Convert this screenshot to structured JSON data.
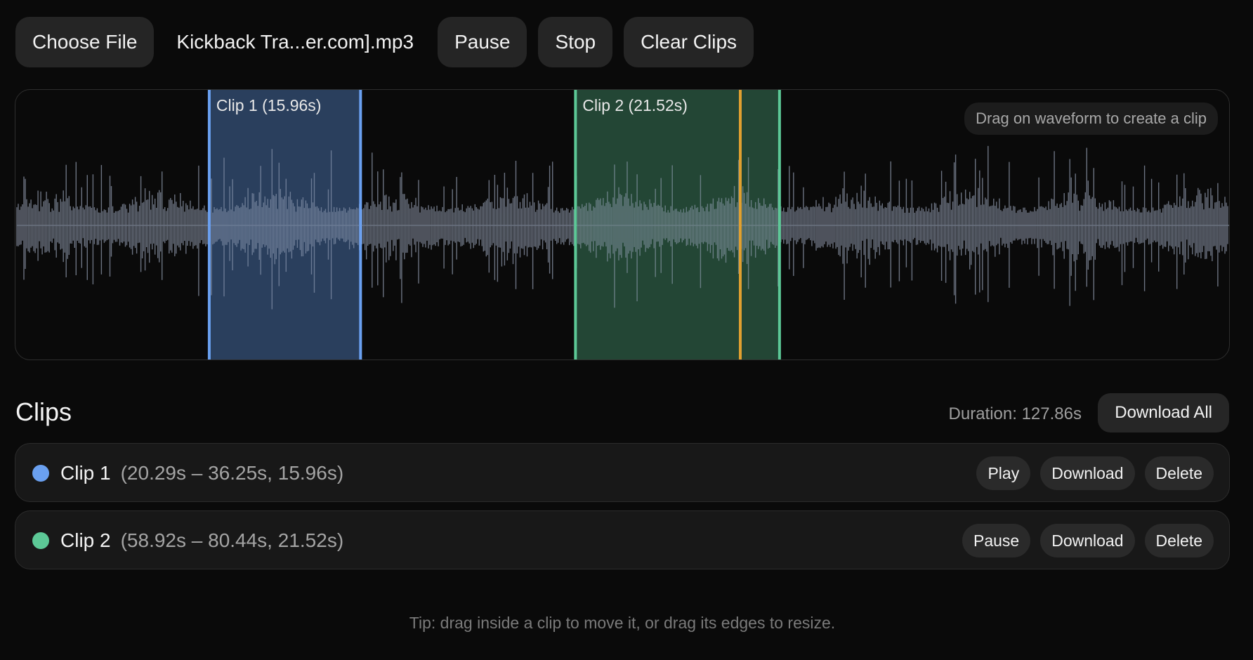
{
  "toolbar": {
    "choose_file_label": "Choose File",
    "file_name": "Kickback Tra...er.com].mp3",
    "pause_label": "Pause",
    "stop_label": "Stop",
    "clear_clips_label": "Clear Clips"
  },
  "waveform": {
    "hint": "Drag on waveform to create a clip",
    "duration_seconds": 127.86,
    "playhead_seconds": 76.3,
    "colors": {
      "waveform": "#6b7280",
      "clip1": "#6aa0f0",
      "clip2": "#5cc896",
      "playhead": "#e0a030"
    }
  },
  "clips_section": {
    "title": "Clips",
    "duration_label": "Duration: 127.86s",
    "download_all_label": "Download All",
    "clips": [
      {
        "name": "Clip 1",
        "start": 20.29,
        "end": 36.25,
        "length": 15.96,
        "label_on_wave": "Clip 1 (15.96s)",
        "range_text": "(20.29s – 36.25s, 15.96s)",
        "color": "#6aa0f0",
        "action_label": "Play",
        "download_label": "Download",
        "delete_label": "Delete"
      },
      {
        "name": "Clip 2",
        "start": 58.92,
        "end": 80.44,
        "length": 21.52,
        "label_on_wave": "Clip 2 (21.52s)",
        "range_text": "(58.92s – 80.44s, 21.52s)",
        "color": "#5cc896",
        "action_label": "Pause",
        "download_label": "Download",
        "delete_label": "Delete"
      }
    ]
  },
  "tip": "Tip: drag inside a clip to move it, or drag its edges to resize."
}
